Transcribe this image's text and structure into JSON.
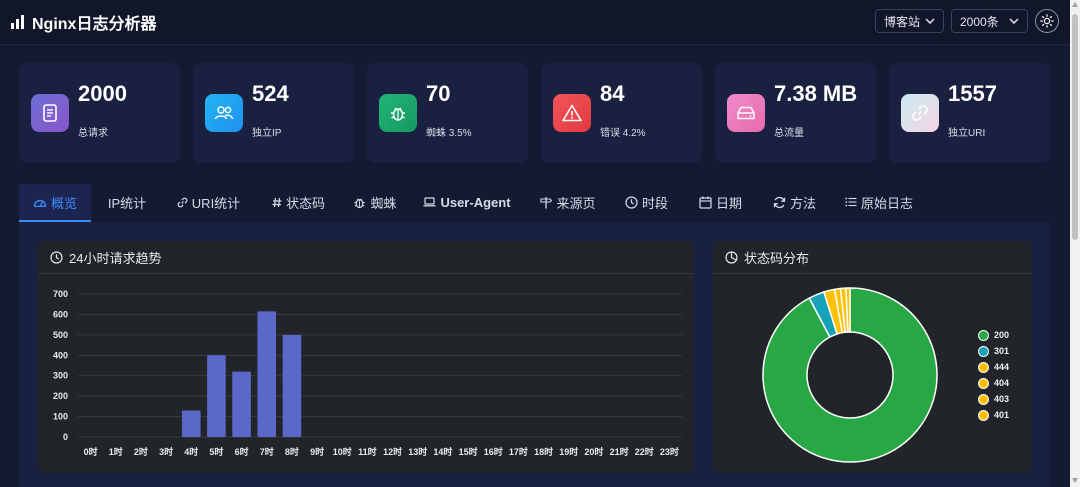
{
  "app": {
    "title": "Nginx日志分析器"
  },
  "controls": {
    "site_select": "博客站",
    "count_select": "2000条"
  },
  "stats": [
    {
      "value": "2000",
      "label": "总请求",
      "icon": "document-icon",
      "gradient": [
        "#6b6fd6",
        "#8a55c9"
      ]
    },
    {
      "value": "524",
      "label": "独立IP",
      "icon": "users-icon",
      "gradient": [
        "#23b6f2",
        "#1f8ff0"
      ]
    },
    {
      "value": "70",
      "label": "蜘蛛 3.5%",
      "icon": "bug-icon",
      "gradient": [
        "#21b47a",
        "#15985f"
      ]
    },
    {
      "value": "84",
      "label": "错误 4.2%",
      "icon": "warning-icon",
      "gradient": [
        "#f2555a",
        "#e03a3f"
      ]
    },
    {
      "value": "7.38 MB",
      "label": "总流量",
      "icon": "drive-icon",
      "gradient": [
        "#f08bc9",
        "#e76aae"
      ]
    },
    {
      "value": "1557",
      "label": "独立URI",
      "icon": "link-icon",
      "gradient": [
        "#c9ecf2",
        "#f5d4e3"
      ]
    }
  ],
  "tabs": [
    {
      "label": "概览",
      "icon": "dashboard-icon",
      "active": true
    },
    {
      "label": "IP统计",
      "icon": "",
      "active": false
    },
    {
      "label": "URI统计",
      "icon": "link-icon",
      "active": false
    },
    {
      "label": "状态码",
      "icon": "hash-icon",
      "active": false
    },
    {
      "label": "蜘蛛",
      "icon": "bug-icon",
      "active": false
    },
    {
      "label": "User-Agent",
      "icon": "laptop-icon",
      "active": false
    },
    {
      "label": "来源页",
      "icon": "signpost-icon",
      "active": false
    },
    {
      "label": "时段",
      "icon": "clock-icon",
      "active": false
    },
    {
      "label": "日期",
      "icon": "calendar-icon",
      "active": false
    },
    {
      "label": "方法",
      "icon": "refresh-icon",
      "active": false
    },
    {
      "label": "原始日志",
      "icon": "list-icon",
      "active": false
    }
  ],
  "panels": {
    "trend_title": "24小时请求趋势",
    "status_title": "状态码分布"
  },
  "colors": {
    "accent": "#3d8bfd",
    "bar": "#5b67c9"
  },
  "chart_data": [
    {
      "type": "bar",
      "title": "24小时请求趋势",
      "categories": [
        "0时",
        "1时",
        "2时",
        "3时",
        "4时",
        "5时",
        "6时",
        "7时",
        "8时",
        "9时",
        "10时",
        "11时",
        "12时",
        "13时",
        "14时",
        "15时",
        "16时",
        "17时",
        "18时",
        "19时",
        "20时",
        "21时",
        "22时",
        "23时"
      ],
      "values": [
        0,
        0,
        0,
        0,
        130,
        400,
        320,
        615,
        500,
        0,
        0,
        0,
        0,
        0,
        0,
        0,
        0,
        0,
        0,
        0,
        0,
        0,
        0,
        0
      ],
      "ylim": [
        0,
        700
      ],
      "yticks": [
        0,
        100,
        200,
        300,
        400,
        500,
        600,
        700
      ],
      "grid": true
    },
    {
      "type": "pie",
      "title": "状态码分布",
      "donut": true,
      "legend_position": "right",
      "labels": [
        "200",
        "301",
        "444",
        "404",
        "403",
        "401"
      ],
      "values": [
        1845,
        58,
        40,
        22,
        20,
        15
      ],
      "colors": [
        "#28a745",
        "#17a2b8",
        "#ffc107",
        "#ffc107",
        "#ffc107",
        "#ffc107"
      ]
    }
  ]
}
